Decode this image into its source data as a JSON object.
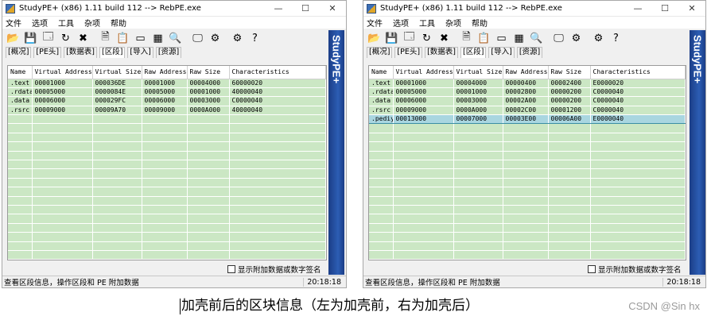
{
  "toolbar_icons": [
    {
      "name": "open-folder-icon",
      "glyph": "📂"
    },
    {
      "name": "save-icon",
      "glyph": "💾"
    },
    {
      "name": "window-icon",
      "glyph": "🗔"
    },
    {
      "name": "refresh-icon",
      "glyph": "↻"
    },
    {
      "name": "close-file-icon",
      "glyph": "✖"
    },
    {
      "name": "sep"
    },
    {
      "name": "document-icon",
      "glyph": "🗎"
    },
    {
      "name": "copy-icon",
      "glyph": "📋"
    },
    {
      "name": "asm-icon",
      "glyph": "▭"
    },
    {
      "name": "calculator-icon",
      "glyph": "▦"
    },
    {
      "name": "search-icon",
      "glyph": "🔍"
    },
    {
      "name": "sep"
    },
    {
      "name": "monitor-icon",
      "glyph": "🖵"
    },
    {
      "name": "process-icon",
      "glyph": "⚙"
    },
    {
      "name": "sep"
    },
    {
      "name": "settings-icon",
      "glyph": "⚙"
    },
    {
      "name": "help-icon",
      "glyph": "?"
    }
  ],
  "colors": {
    "panel_green": "#cbe7c4",
    "banner_blue": "#2c5db4",
    "selected_row": "#a9d6e0"
  },
  "windows": [
    {
      "id": "left",
      "title": "StudyPE+ (x86) 1.11 build 112  --> RebPE.exe",
      "controls": {
        "minimize": "—",
        "maximize": "☐",
        "close": "✕"
      },
      "menu": [
        "文件",
        "选项",
        "工具",
        "杂项",
        "帮助"
      ],
      "tabs": [
        "[概况]",
        "[PE头]",
        "[数据表]",
        "[区段]",
        "[导入]",
        "[资源]"
      ],
      "active_tab": 3,
      "banner": "StudyPE+",
      "columns": [
        "Name",
        "Virtual Address",
        "Virtual Size",
        "Raw Address",
        "Raw Size",
        "Characteristics"
      ],
      "rows": [
        [
          ".text",
          "00001000",
          "000036DE",
          "00001000",
          "00004000",
          "60000020"
        ],
        [
          ".rdata",
          "00005000",
          "0000084E",
          "00005000",
          "00001000",
          "40000040"
        ],
        [
          ".data",
          "00006000",
          "000029FC",
          "00006000",
          "00003000",
          "C0000040"
        ],
        [
          ".rsrc",
          "00009000",
          "00009A70",
          "00009000",
          "0000A000",
          "40000040"
        ]
      ],
      "selected_row": -1,
      "checkbox_label": "显示附加数据或数字签名",
      "status_text": "查看区段信息，操作区段和 PE 附加数据",
      "status_time": "20:18:18"
    },
    {
      "id": "right",
      "title": "StudyPE+ (x86) 1.11 build 112  --> RebPE.exe",
      "controls": {
        "minimize": "—",
        "maximize": "☐",
        "close": "✕"
      },
      "menu": [
        "文件",
        "选项",
        "工具",
        "杂项",
        "帮助"
      ],
      "tabs": [
        "[概况]",
        "[PE头]",
        "[数据表]",
        "[区段]",
        "[导入]",
        "[资源]"
      ],
      "active_tab": 3,
      "banner": "StudyPE+",
      "columns": [
        "Name",
        "Virtual Address",
        "Virtual Size",
        "Raw Address",
        "Raw Size",
        "Characteristics"
      ],
      "rows": [
        [
          ".text",
          "00001000",
          "00004000",
          "00000400",
          "00002400",
          "E0000020"
        ],
        [
          ".rdata",
          "00005000",
          "00001000",
          "00002800",
          "00000200",
          "C0000040"
        ],
        [
          ".data",
          "00006000",
          "00003000",
          "00002A00",
          "00000200",
          "C0000040"
        ],
        [
          ".rsrc",
          "00009000",
          "0000A000",
          "00002C00",
          "00001200",
          "C0000040"
        ],
        [
          ".pediy",
          "00013000",
          "00007000",
          "00003E00",
          "00006A00",
          "E0000040"
        ]
      ],
      "selected_row": 4,
      "checkbox_label": "显示附加数据或数字签名",
      "status_text": "查看区段信息，操作区段和 PE 附加数据",
      "status_time": "20:18:18"
    }
  ],
  "caption": "加壳前后的区块信息（左为加壳前，右为加壳后）",
  "watermark": "CSDN @Sin hx"
}
